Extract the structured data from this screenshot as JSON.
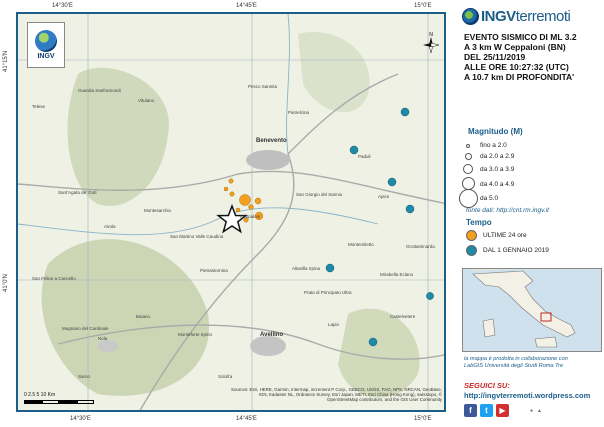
{
  "brand": {
    "ingv": "INGV",
    "terremoti": "terremoti"
  },
  "badge_text": "INGV",
  "event": {
    "line1": "EVENTO SISMICO DI ML 3.2",
    "line2": "A 3 km W Ceppaloni (BN)",
    "line3": "DEL 25/11/2019",
    "line4": "ALLE ORE 10:27:32 (UTC)",
    "line5": "A 10.7 km DI PROFONDITA'"
  },
  "magnitude": {
    "title": "Magnitudo (M)",
    "classes": [
      {
        "label": "fino a 2.0"
      },
      {
        "label": "da 2.0 a 2.9"
      },
      {
        "label": "da 3.0 a 3.9"
      },
      {
        "label": "da 4.0 a 4.9"
      },
      {
        "label": "da 5.0"
      }
    ]
  },
  "fonte": "fonte dati: http://cnt.rm.ingv.it",
  "tempo": {
    "title": "Tempo",
    "items": [
      {
        "label": "ULTIME 24 ore",
        "color": "#f2a01e"
      },
      {
        "label": "DAL 1 GENNAIO 2019",
        "color": "#1f8aa8"
      }
    ]
  },
  "collab": {
    "line1": "la mappa è prodotta in collaborazione con",
    "line2": "LabGIS Università degli Studi Roma Tre"
  },
  "seguici": "SEGUICI SU:",
  "blog_url": "http://ingvterremoti.wordpress.com",
  "coords": {
    "top": [
      "14°30'E",
      "14°45'E",
      "15°0'E"
    ],
    "bottom": [
      "14°30'E",
      "14°45'E",
      "15°0'E"
    ],
    "left": [
      "41°15'N",
      "41°0'N"
    ]
  },
  "scale": {
    "labels": "0  2.5   5       10",
    "unit": "Km"
  },
  "attribution": "Sources: Esri, HERE, Garmin, Intermap, increment P Corp., GEBCO, USGS, FAO, NPS, NRCAN, GeoBase, IGN, Kadaster NL, Ordnance Survey, Esri Japan, METI, Esri China (Hong Kong), swisstopo, © OpenStreetMap contributors, and the GIS User Community",
  "towns": [
    "Benevento",
    "Montesarchio",
    "Avellino",
    "San Giorgio del Sannio",
    "Ceppaloni",
    "Pietrastornina",
    "Sant'Agata de' Goti",
    "San Felice a Cancello",
    "Airola",
    "Mugnano del Cardinale",
    "Paduli",
    "Apice",
    "Montemiletto",
    "Lapio",
    "Telese",
    "Guardia Sanframondi",
    "Pesco Sannita",
    "Pietrelcina",
    "San Martino Valle Caudina",
    "Altavilla Irpina",
    "Prata di Principato Ultra",
    "Mirabella Eclano",
    "Grottaminarda",
    "Solofra",
    "Monteforte Irpino",
    "Nola",
    "Sarno",
    "Castelvetere",
    "Baiano",
    "Vitulano"
  ],
  "colors": {
    "frame": "#1b5e8a",
    "recent": "#f2a01e",
    "year": "#1f8aa8"
  }
}
